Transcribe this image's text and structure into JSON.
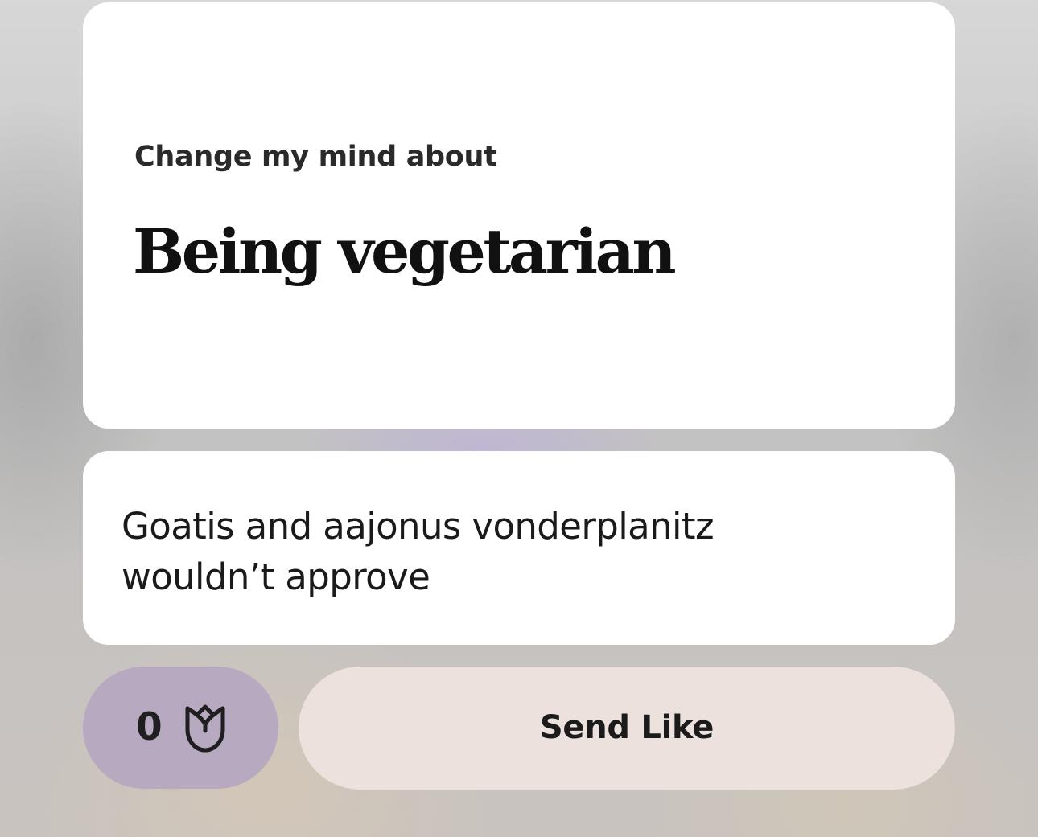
{
  "prompt": {
    "label": "Change my mind about",
    "title": "Being vegetarian"
  },
  "answer": {
    "text": "Goatis and aajonus vonderplanitz wouldn’t approve"
  },
  "actions": {
    "rose_count": "0",
    "rose_icon": "rose-icon",
    "send_like_label": "Send Like"
  },
  "colors": {
    "card_background": "#ffffff",
    "rose_button": "#b6a9c0",
    "send_like_button": "#ece1dd",
    "text_dark": "#111111"
  }
}
